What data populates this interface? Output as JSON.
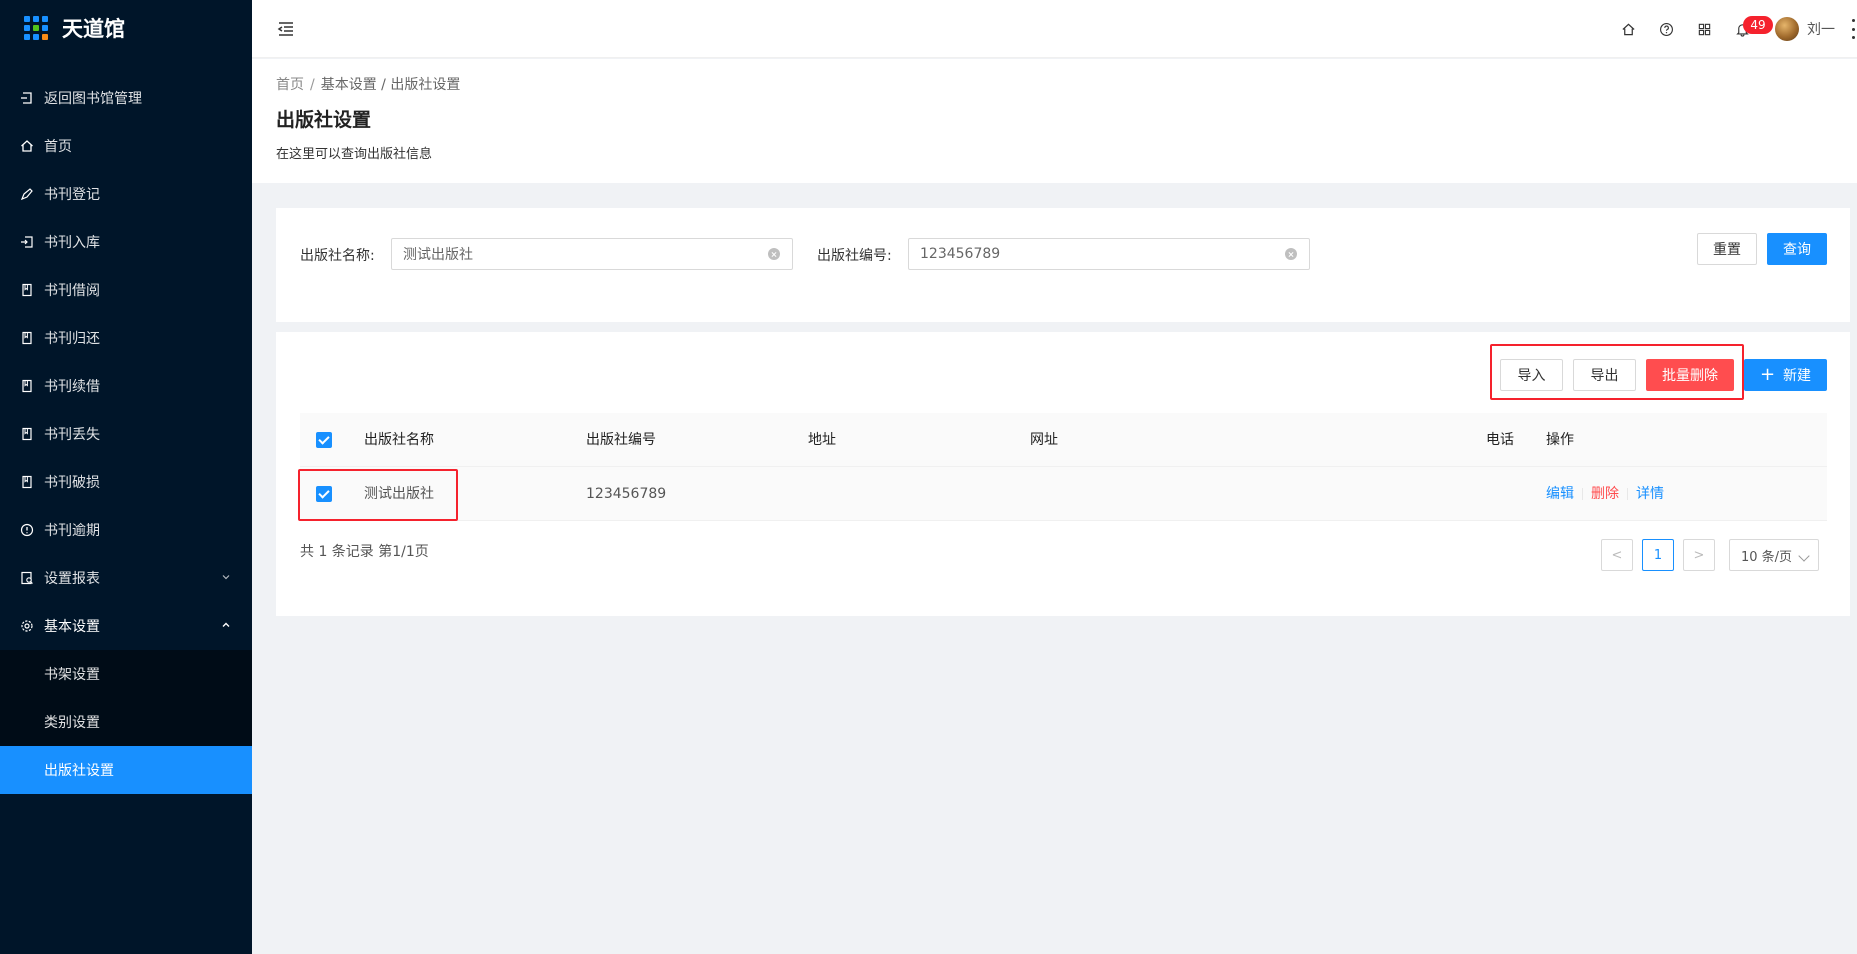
{
  "app": {
    "title": "天道馆"
  },
  "sidebar": {
    "items": [
      {
        "label": "返回图书馆管理",
        "icon": "return-icon"
      },
      {
        "label": "首页",
        "icon": "home-icon"
      },
      {
        "label": "书刊登记",
        "icon": "pen-icon"
      },
      {
        "label": "书刊入库",
        "icon": "login-icon"
      },
      {
        "label": "书刊借阅",
        "icon": "book-icon"
      },
      {
        "label": "书刊归还",
        "icon": "book-icon"
      },
      {
        "label": "书刊续借",
        "icon": "book-icon"
      },
      {
        "label": "书刊丢失",
        "icon": "book-icon"
      },
      {
        "label": "书刊破损",
        "icon": "book-icon"
      },
      {
        "label": "书刊逾期",
        "icon": "exclamation-circle-icon"
      },
      {
        "label": "设置报表",
        "icon": "report-icon"
      },
      {
        "label": "基本设置",
        "icon": "gear-icon"
      }
    ],
    "submenu": [
      {
        "label": "书架设置"
      },
      {
        "label": "类别设置"
      },
      {
        "label": "出版社设置"
      }
    ]
  },
  "header": {
    "notification_count": "49",
    "username": "刘一"
  },
  "page": {
    "breadcrumb": [
      "首页",
      "基本设置",
      "出版社设置"
    ],
    "title": "出版社设置",
    "description": "在这里可以查询出版社信息"
  },
  "search": {
    "name_label": "出版社名称:",
    "name_value": "测试出版社",
    "code_label": "出版社编号:",
    "code_value": "123456789",
    "reset_label": "重置",
    "query_label": "查询"
  },
  "toolbar": {
    "import_label": "导入",
    "export_label": "导出",
    "batch_delete_label": "批量删除",
    "new_label": "新建"
  },
  "table": {
    "columns": [
      "出版社名称",
      "出版社编号",
      "地址",
      "网址",
      "电话",
      "操作"
    ],
    "rows": [
      {
        "name": "测试出版社",
        "code": "123456789",
        "address": "",
        "website": "",
        "phone": "",
        "checked": true
      }
    ],
    "actions": {
      "edit": "编辑",
      "delete": "删除",
      "detail": "详情"
    }
  },
  "pagination": {
    "total_text": "共 1 条记录 第1/1页",
    "current_page": "1",
    "page_size": "10 条/页"
  },
  "colors": {
    "primary": "#1890ff",
    "danger": "#ff4d4f",
    "sidebar": "#001529"
  }
}
